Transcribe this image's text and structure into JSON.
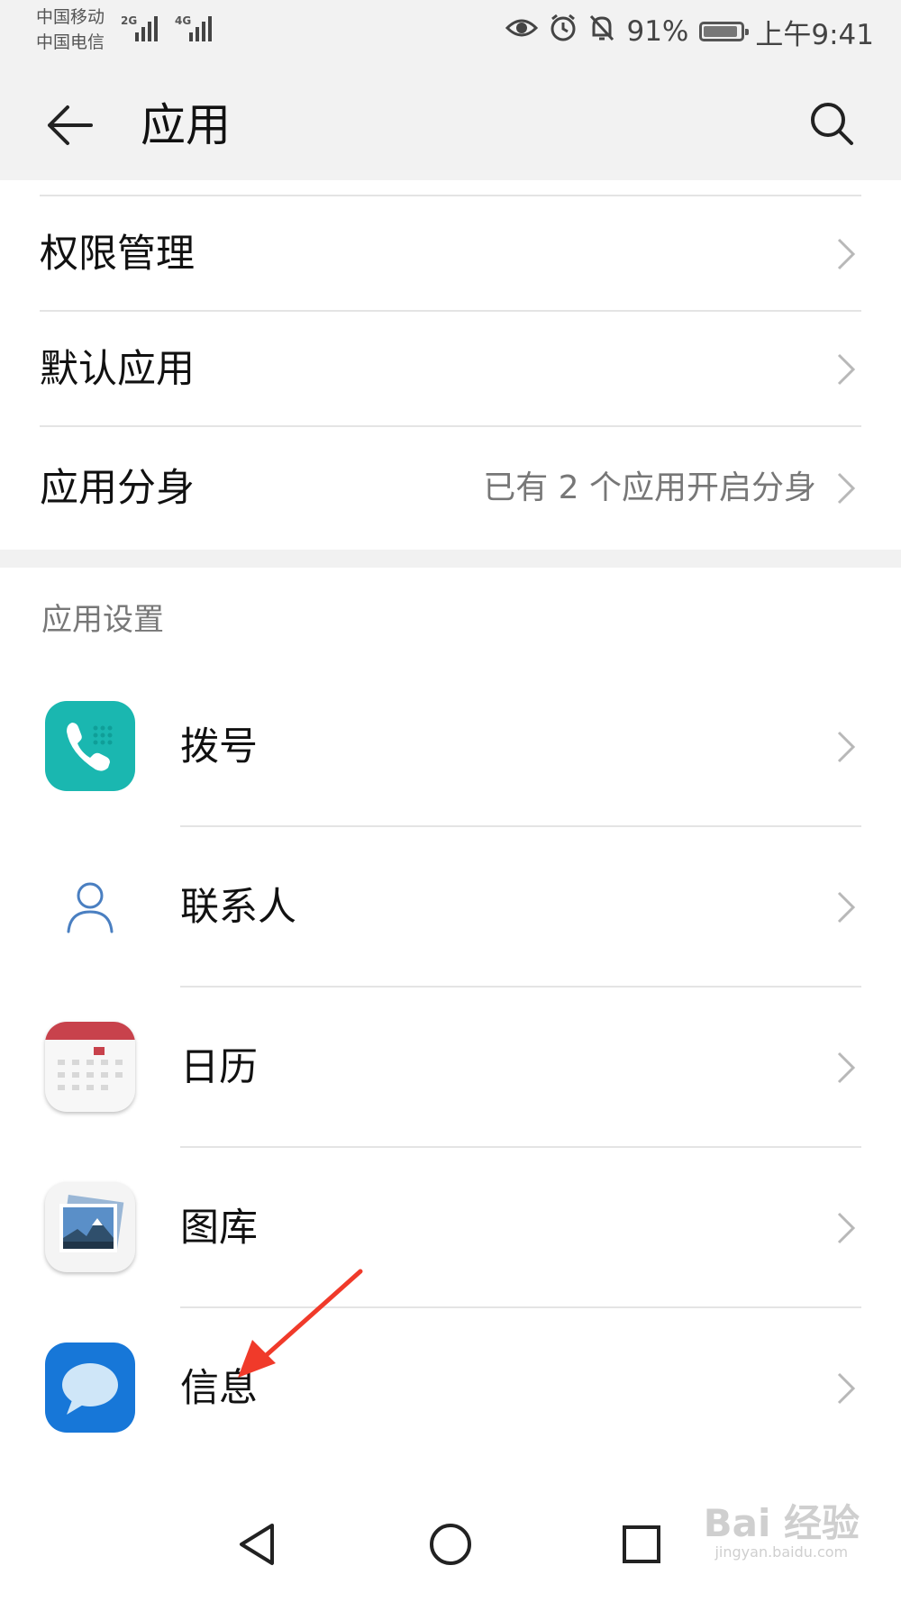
{
  "status_bar": {
    "carrier_1": "中国移动",
    "carrier_2": "中国电信",
    "network_1": "2G",
    "network_2": "4G",
    "battery_level": "91%",
    "battery_fraction": 0.91,
    "time": "上午9:41",
    "icons": [
      "eye-comfort-icon",
      "alarm-icon",
      "notification-off-icon",
      "battery-icon"
    ]
  },
  "header": {
    "title": "应用",
    "back_icon": "arrow-left-icon",
    "search_icon": "search-icon"
  },
  "settings_list": [
    {
      "label": "权限管理",
      "value": ""
    },
    {
      "label": "默认应用",
      "value": ""
    },
    {
      "label": "应用分身",
      "value": "已有 2 个应用开启分身"
    }
  ],
  "app_settings": {
    "section_title": "应用设置",
    "apps": [
      {
        "label": "拨号",
        "icon": "phone-icon"
      },
      {
        "label": "联系人",
        "icon": "contact-icon"
      },
      {
        "label": "日历",
        "icon": "calendar-icon"
      },
      {
        "label": "图库",
        "icon": "gallery-icon"
      },
      {
        "label": "信息",
        "icon": "message-icon"
      }
    ]
  },
  "nav_bar": {
    "icons": [
      "back-triangle-icon",
      "home-circle-icon",
      "recents-square-icon"
    ]
  },
  "watermark": {
    "brand": "Bai 经验",
    "url": "jingyan.baidu.com"
  },
  "colors": {
    "header_bg": "#f2f2f2",
    "phone_icon": "#1ab7b0",
    "calendar_red": "#c8424c",
    "message_blue": "#1777d8",
    "arrow_red": "#f03a2a",
    "contact_stroke": "#4a7fc1"
  }
}
